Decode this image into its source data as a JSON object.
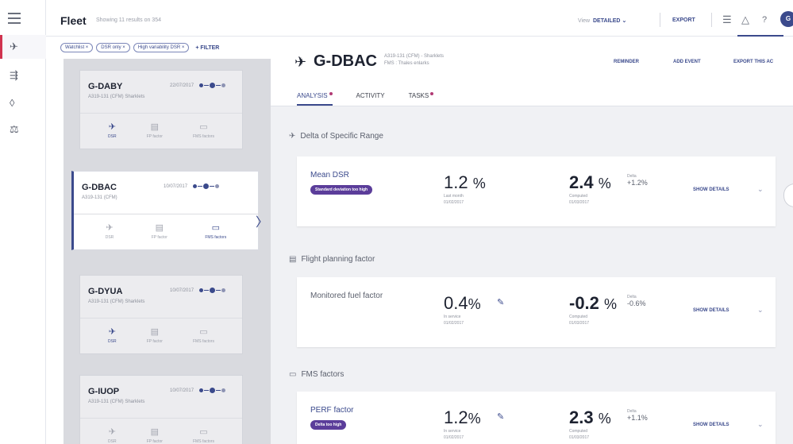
{
  "topbar": {
    "title": "Fleet",
    "subtitle": "Showing 11 results on 354",
    "view_label": "View",
    "view_value": "DETAILED",
    "export_label": "EXPORT"
  },
  "filters": {
    "chips": [
      "Watchlist",
      "DSR only",
      "High variability DSR"
    ],
    "add_label": "+ FILTER"
  },
  "list": [
    {
      "reg": "G-DABY",
      "model": "A319-131 (CFM) Sharklets",
      "date": "22/07/2017",
      "tools": [
        "DSR",
        "FP factor",
        "FMS factors"
      ],
      "active_tool": 0
    },
    {
      "reg": "G-DBAC",
      "model": "A319-131 (CFM)",
      "date": "10/07/2017",
      "tools": [
        "DSR",
        "FP factor",
        "FMS factors"
      ],
      "active_tool": 2
    },
    {
      "reg": "G-DYUA",
      "model": "A319-131 (CFM) Sharklets",
      "date": "10/07/2017",
      "tools": [
        "DSR",
        "FP factor",
        "FMS factors"
      ],
      "active_tool": 0
    },
    {
      "reg": "G-IUOP",
      "model": "A319-131 (CFM) Sharklets",
      "date": "10/07/2017",
      "tools": [
        "DSR",
        "FP factor",
        "FMS factors"
      ],
      "active_tool": 0
    }
  ],
  "detail": {
    "reg": "G-DBAC",
    "meta_line1": "A319-131 (CFM) - Sharklets",
    "meta_line2": "FMS : Thales enlarks",
    "actions": [
      "REMINDER",
      "ADD EVENT",
      "EXPORT THIS AC"
    ],
    "tabs": [
      {
        "label": "ANALYSIS",
        "dot": true
      },
      {
        "label": "ACTIVITY",
        "dot": false
      },
      {
        "label": "TASKS",
        "dot": true
      }
    ],
    "sections": [
      {
        "title": "Delta of Specific Range",
        "icon": "plane-gauge-icon",
        "card": {
          "name": "Mean DSR",
          "badge": "Standard deviation too high",
          "value1": "1.2",
          "value1_unit": "%",
          "value1_label": "Last month",
          "value1_date": "01/02/2017",
          "value2": "2.4",
          "value2_unit": "%",
          "value2_label": "Computed",
          "value2_date": "01/03/2017",
          "delta_label": "Delta",
          "delta_value": "+1.2%",
          "action": "SHOW DETAILS"
        }
      },
      {
        "title": "Flight planning factor",
        "icon": "fp-book-icon",
        "card": {
          "name": "Monitored fuel factor",
          "badge": "",
          "value1": "0.4",
          "value1_unit": "%",
          "value1_label": "In service",
          "value1_date": "01/02/2017",
          "value2": "-0.2",
          "value2_unit": "%",
          "value2_label": "Computed",
          "value2_date": "01/03/2017",
          "delta_label": "Delta",
          "delta_value": "-0.6%",
          "action": "SHOW DETAILS"
        }
      },
      {
        "title": "FMS factors",
        "icon": "fms-screen-icon",
        "card": {
          "name": "PERF factor",
          "badge": "Delta too high",
          "value1": "1.2",
          "value1_unit": "%",
          "value1_label": "In service",
          "value1_date": "01/02/2017",
          "value2": "2.3",
          "value2_unit": "%",
          "value2_label": "Computed",
          "value2_date": "01/03/2017",
          "delta_label": "Delta",
          "delta_value": "+1.1%",
          "action": "SHOW DETAILS"
        }
      }
    ]
  }
}
